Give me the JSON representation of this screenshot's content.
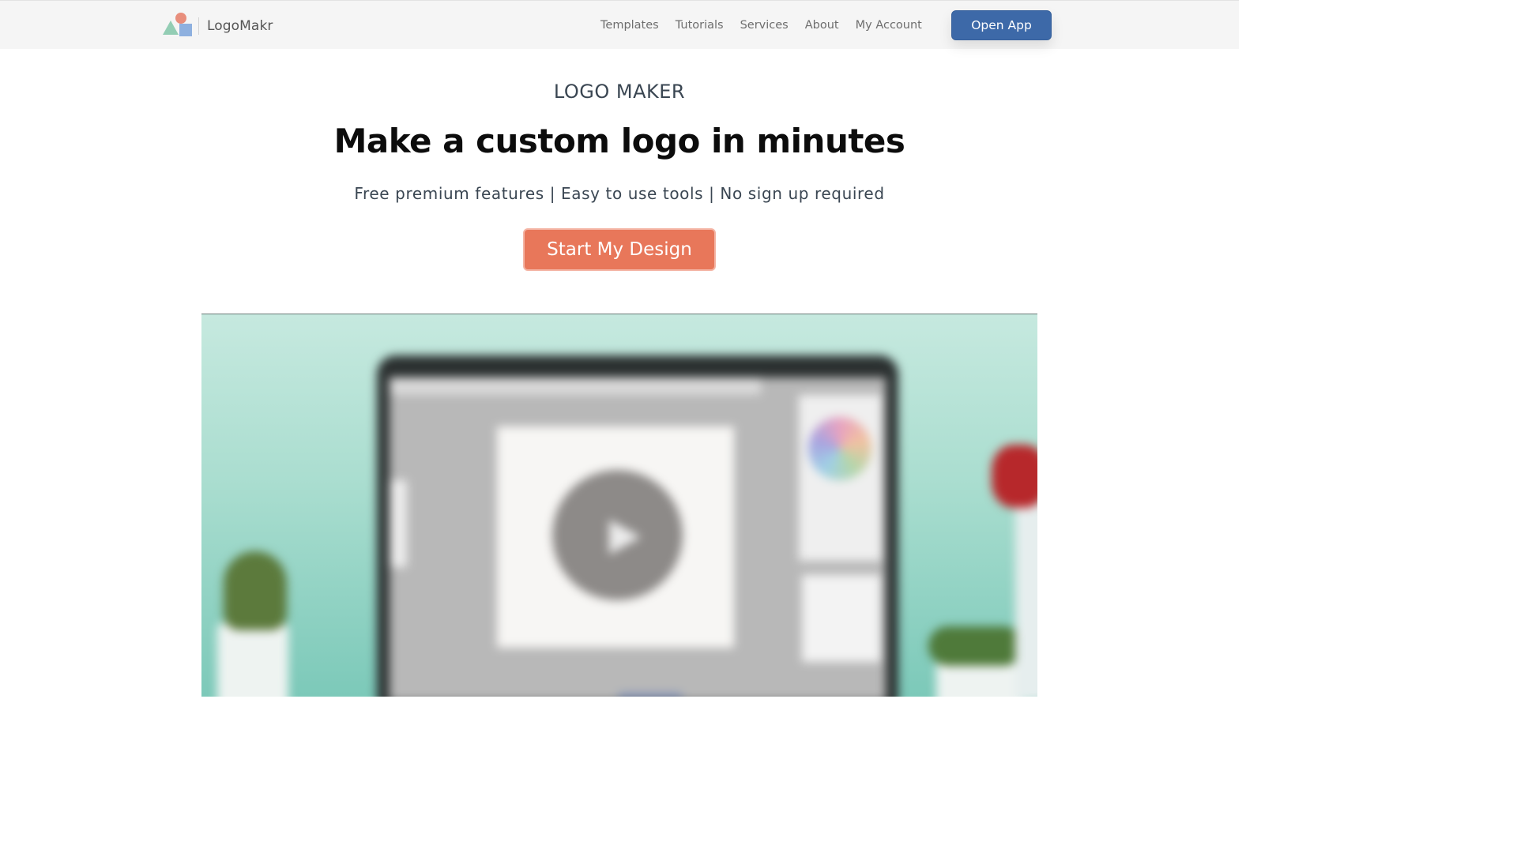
{
  "header": {
    "brand_name": "LogoMakr",
    "nav": [
      "Templates",
      "Tutorials",
      "Services",
      "About",
      "My Account"
    ],
    "open_app_label": "Open App"
  },
  "hero": {
    "eyebrow": "LOGO MAKER",
    "headline": "Make a custom logo in minutes",
    "subline": "Free premium features | Easy to use tools | No sign up required",
    "cta_label": "Start My Design"
  },
  "colors": {
    "header_bg": "#f5f5f5",
    "open_app_bg": "#3d69a8",
    "cta_bg": "#e8775a",
    "headline": "#0c0c0c",
    "body_text": "#3a4652"
  },
  "icons": {
    "brand_mark": "logo-shapes-icon",
    "video_play": "play-icon"
  }
}
